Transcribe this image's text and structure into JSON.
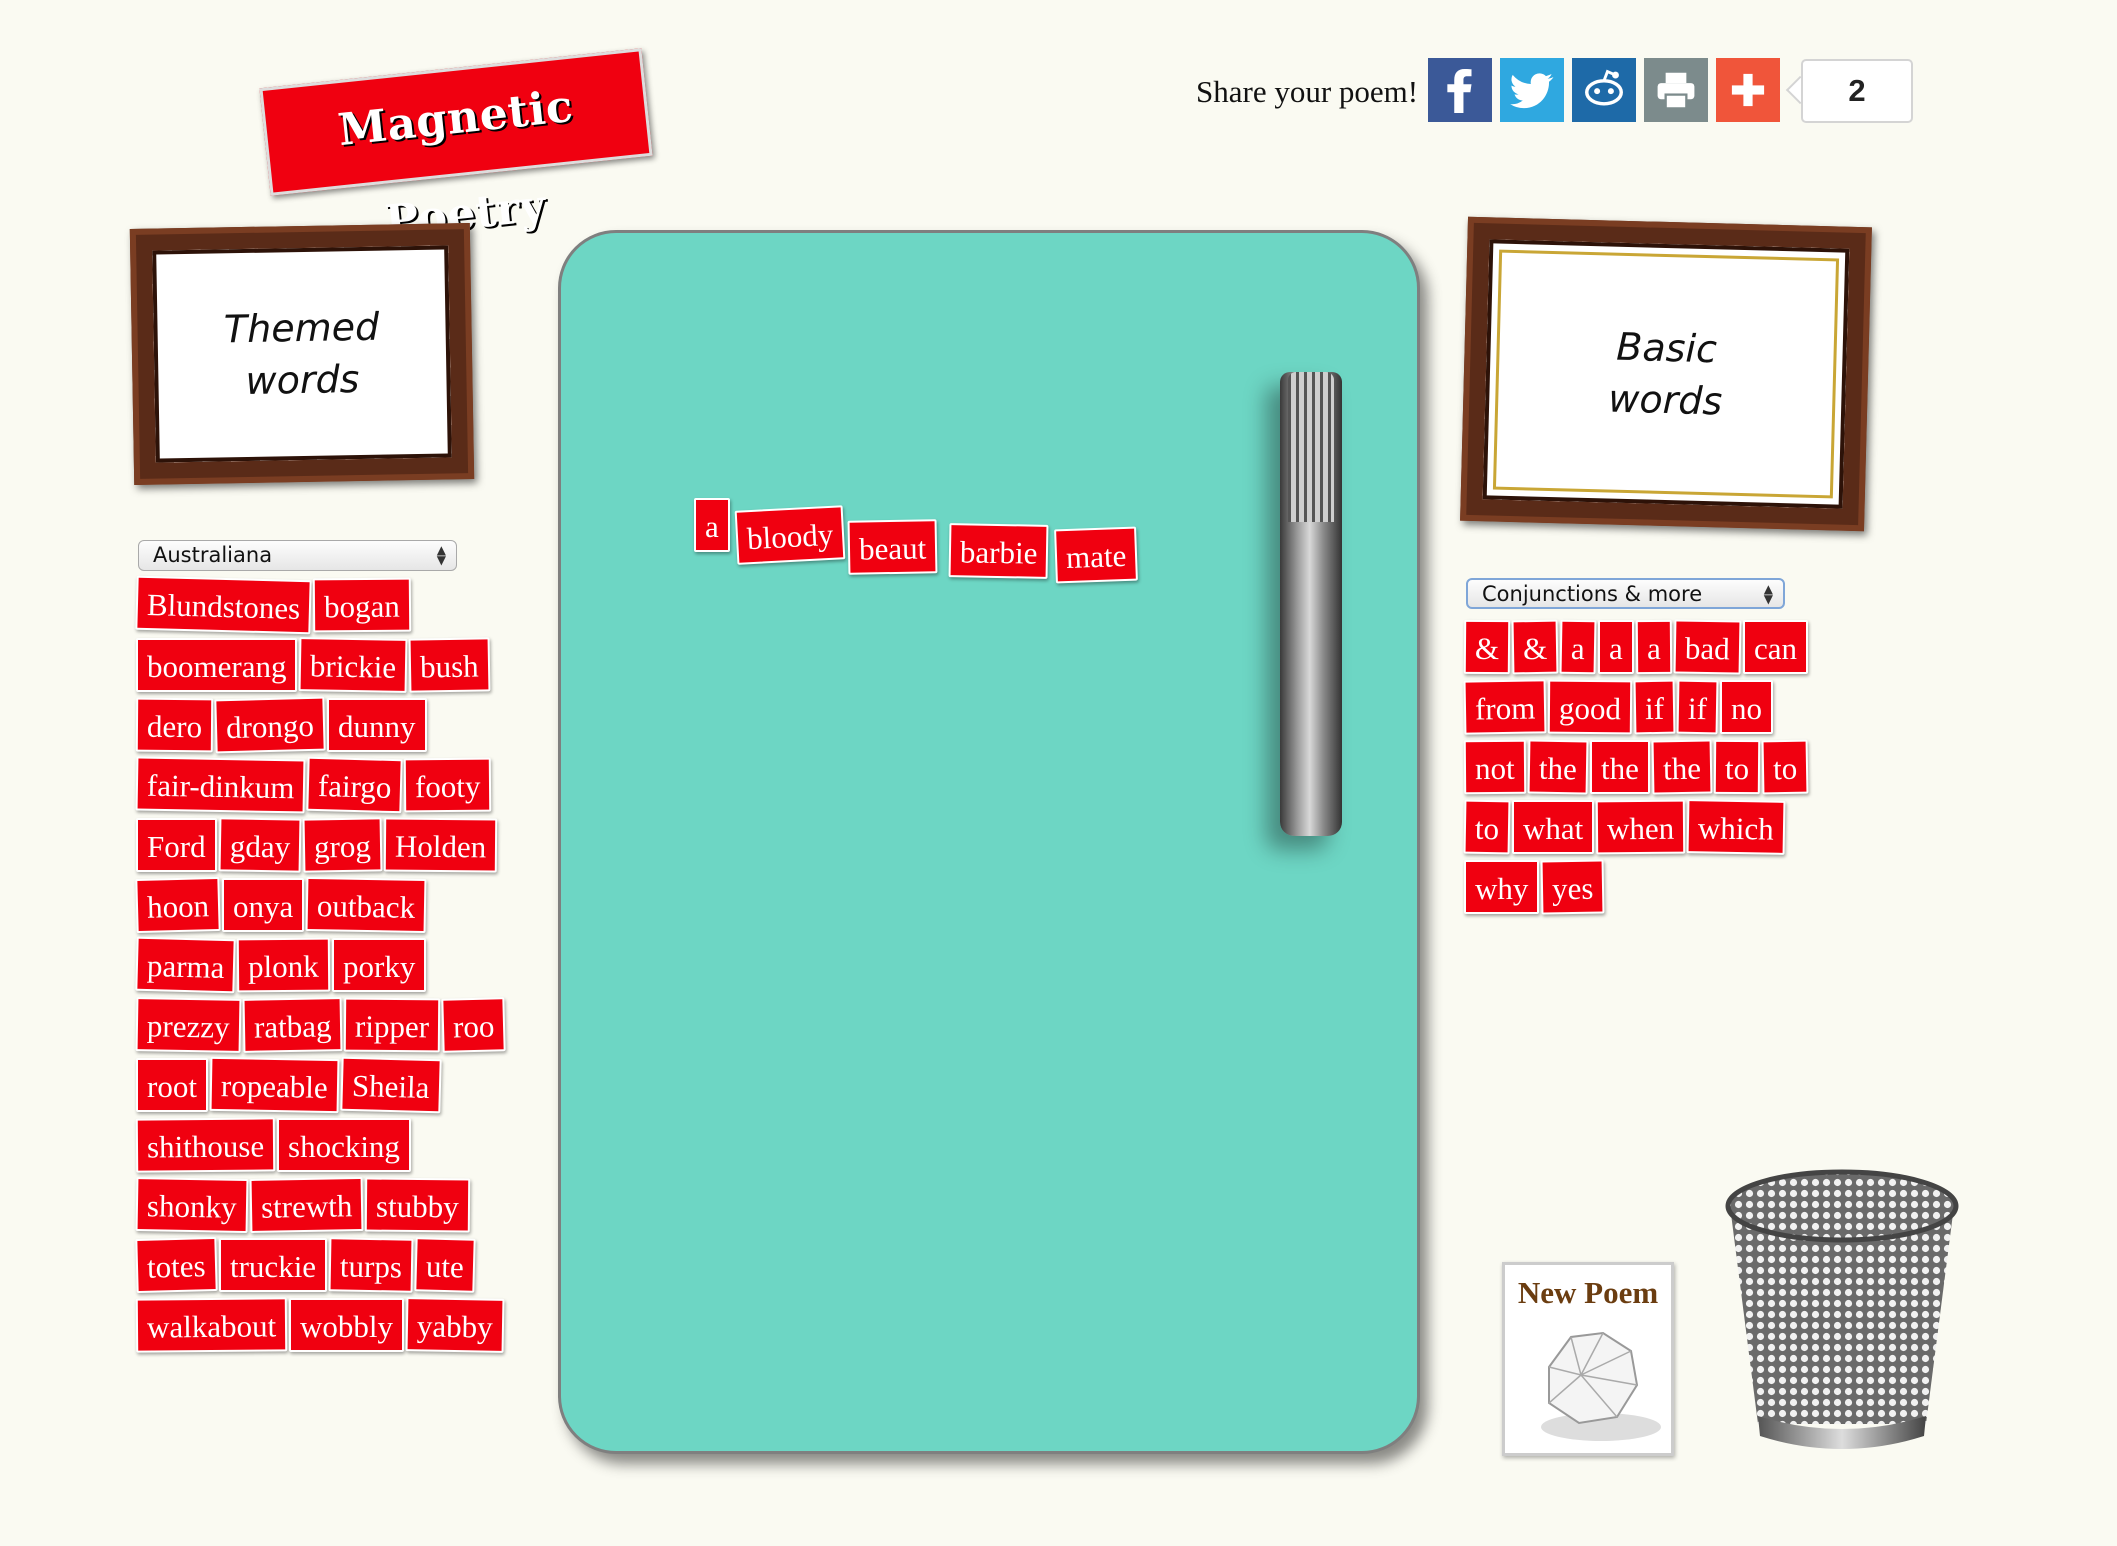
{
  "app": {
    "logo_text": "Magnetic Poetry"
  },
  "share": {
    "label": "Share your poem!",
    "count": "2",
    "buttons": [
      {
        "name": "facebook",
        "icon": "facebook-icon",
        "color": "#3b5998"
      },
      {
        "name": "twitter",
        "icon": "twitter-icon",
        "color": "#2fa8e0"
      },
      {
        "name": "reddit",
        "icon": "reddit-icon",
        "color": "#1e6aa8"
      },
      {
        "name": "print",
        "icon": "print-icon",
        "color": "#7c8b8c"
      },
      {
        "name": "more",
        "icon": "plus-icon",
        "color": "#f0553a"
      }
    ]
  },
  "themed": {
    "frame_label": "Themed\nwords",
    "select_value": "Australiana",
    "words": [
      "Blundstones",
      "bogan",
      "boomerang",
      "brickie",
      "bush",
      "dero",
      "drongo",
      "dunny",
      "fair-dinkum",
      "fairgo",
      "footy",
      "Ford",
      "gday",
      "grog",
      "Holden",
      "hoon",
      "onya",
      "outback",
      "parma",
      "plonk",
      "porky",
      "prezzy",
      "ratbag",
      "ripper",
      "roo",
      "root",
      "ropeable",
      "Sheila",
      "shithouse",
      "shocking",
      "shonky",
      "strewth",
      "stubby",
      "totes",
      "truckie",
      "turps",
      "ute",
      "walkabout",
      "wobbly",
      "yabby"
    ]
  },
  "basic": {
    "frame_label": "Basic\nwords",
    "select_value": "Conjunctions & more",
    "words": [
      "&",
      "&",
      "a",
      "a",
      "a",
      "bad",
      "can",
      "from",
      "good",
      "if",
      "if",
      "no",
      "not",
      "the",
      "the",
      "the",
      "to",
      "to",
      "to",
      "what",
      "when",
      "which",
      "why",
      "yes"
    ]
  },
  "board": {
    "words": [
      "a",
      "bloody",
      "beaut",
      "barbie",
      "mate"
    ]
  },
  "new_poem": {
    "label": "New Poem"
  },
  "colors": {
    "tile": "#f00010",
    "board": "#6dd6c4",
    "background": "#fafaf2"
  }
}
